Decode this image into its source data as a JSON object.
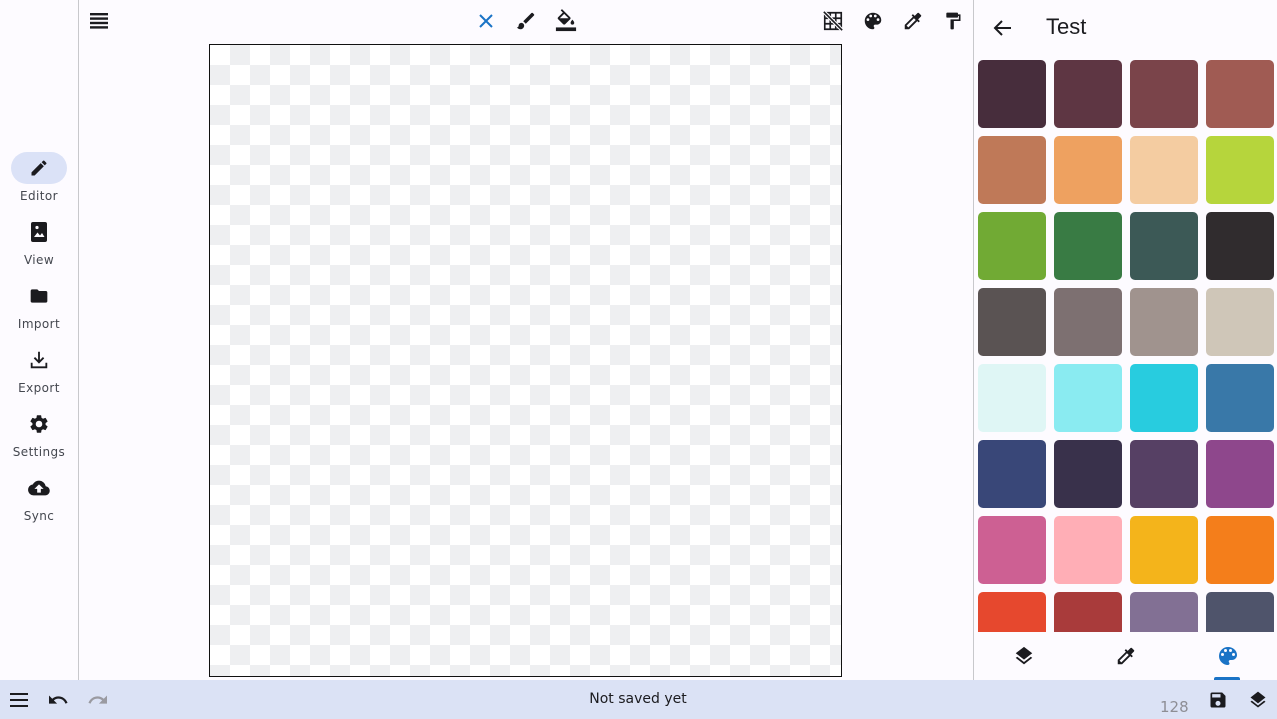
{
  "nav": {
    "items": [
      {
        "label": "Editor",
        "icon": "pencil-icon",
        "active": true
      },
      {
        "label": "View",
        "icon": "image-book-icon",
        "active": false
      },
      {
        "label": "Import",
        "icon": "folder-icon",
        "active": false
      },
      {
        "label": "Export",
        "icon": "download-icon",
        "active": false
      },
      {
        "label": "Settings",
        "icon": "gear-icon",
        "active": false
      },
      {
        "label": "Sync",
        "icon": "cloud-upload-icon",
        "active": false
      }
    ]
  },
  "toolbar": {
    "left_icon": "layers-menu-icon",
    "tools": [
      "close-icon",
      "brush-icon",
      "paint-bucket-icon"
    ],
    "right_tools": [
      "grid-off-icon",
      "palette-icon",
      "eyedropper-icon",
      "paint-roller-icon"
    ],
    "accent": "#1a73c6"
  },
  "panel": {
    "title": "Test",
    "back_icon": "arrow-back-icon",
    "swatches": [
      "#472d3c",
      "#5e3643",
      "#7a444a",
      "#a05b53",
      "#bf7958",
      "#eea160",
      "#f4cca1",
      "#b6d53c",
      "#71aa34",
      "#397b44",
      "#3c5956",
      "#302c2e",
      "#5a5353",
      "#7d7071",
      "#a0938e",
      "#cfc6b8",
      "#dff6f5",
      "#8aebf1",
      "#28ccdf",
      "#3978a8",
      "#394778",
      "#39314b",
      "#564064",
      "#8e478c",
      "#cd6093",
      "#ffaeb6",
      "#f4b41b",
      "#f47e1b",
      "#e6482e",
      "#a93b3b",
      "#827094",
      "#4f546b"
    ],
    "tabs": [
      "layers-icon",
      "eyedropper-icon",
      "palette-icon"
    ],
    "active_tab": 2
  },
  "bottom": {
    "status": "Not saved yet",
    "size": "128",
    "icons": [
      "menu-icon",
      "undo-icon",
      "redo-icon",
      "save-icon",
      "layers-icon"
    ]
  }
}
